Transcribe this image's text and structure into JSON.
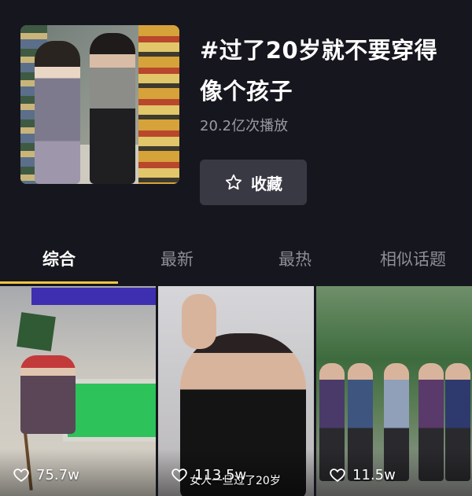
{
  "topic": {
    "title": "#过了20岁就不要穿得像个孩子",
    "plays": "20.2亿次播放",
    "favorite_label": "收藏"
  },
  "tabs": [
    {
      "label": "综合",
      "active": true
    },
    {
      "label": "最新",
      "active": false
    },
    {
      "label": "最热",
      "active": false
    },
    {
      "label": "相似话题",
      "active": false
    }
  ],
  "videos": [
    {
      "likes": "75.7w",
      "caption": ""
    },
    {
      "likes": "113.5w",
      "caption": "女人一旦过了20岁"
    },
    {
      "likes": "11.5w",
      "caption": ""
    }
  ],
  "colors": {
    "background": "#16161e",
    "tab_indicator": "#f6c545",
    "button_bg": "#393944"
  },
  "icons": {
    "favorite": "star-outline-icon",
    "like": "heart-outline-icon"
  }
}
